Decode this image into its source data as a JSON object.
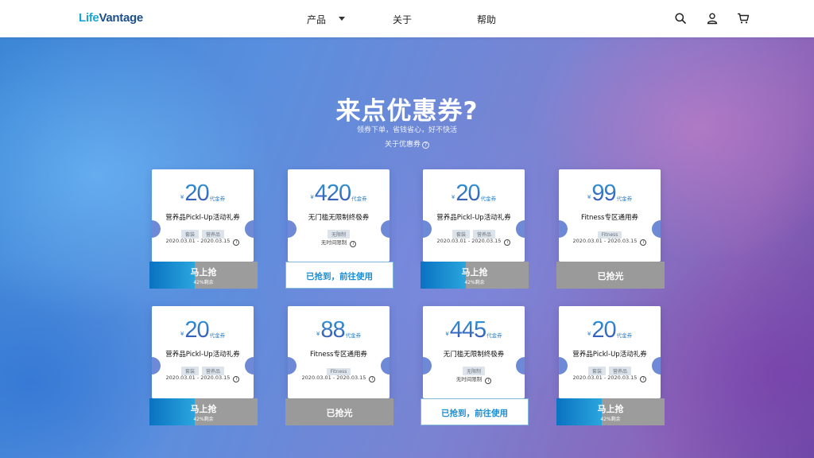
{
  "header": {
    "logo_part1": "Life",
    "logo_part2": "Vantage",
    "nav": [
      {
        "label": "产品",
        "has_dropdown": true
      },
      {
        "label": "关于"
      },
      {
        "label": "帮助"
      }
    ],
    "icons": [
      "search-icon",
      "user-icon",
      "cart-icon"
    ]
  },
  "hero": {
    "title": "来点优惠券?",
    "subtitle": "领券下单，省钱省心，好不快活",
    "link": "关于优惠券",
    "link_icon": "?"
  },
  "colors": {
    "brand_light": "#1aa5d6",
    "brand_dark": "#1d4f8a",
    "button_blue": "#1b8fd2",
    "button_gray": "#9c9c9c"
  },
  "coupons": [
    {
      "currency": "¥",
      "amount": "20",
      "unit": "代金券",
      "name": "营养品Pickl-Up活动礼券",
      "tags": [
        "套装",
        "营养品"
      ],
      "validity": "2020.03.01 - 2020.03.15",
      "state": "grab",
      "button_label": "马上抢",
      "remaining_label": "42%剩余",
      "remaining_pct": 42
    },
    {
      "currency": "¥",
      "amount": "420",
      "unit": "代金券",
      "name": "无门槛无限制终极券",
      "tags": [
        "无限制"
      ],
      "validity": "无时间限制",
      "state": "used",
      "button_label": "已抢到，前往使用"
    },
    {
      "currency": "¥",
      "amount": "20",
      "unit": "代金券",
      "name": "营养品Pickl-Up活动礼券",
      "tags": [
        "套装",
        "营养品"
      ],
      "validity": "2020.03.01 - 2020.03.15",
      "state": "grab",
      "button_label": "马上抢",
      "remaining_label": "42%剩余",
      "remaining_pct": 42
    },
    {
      "currency": "¥",
      "amount": "99",
      "unit": "代金券",
      "name": "Fitness专区通用券",
      "tags": [
        "Fitness"
      ],
      "validity": "2020.03.01 - 2020.03.15",
      "state": "sold",
      "button_label": "已抢光"
    },
    {
      "currency": "¥",
      "amount": "20",
      "unit": "代金券",
      "name": "营养品Pickl-Up活动礼券",
      "tags": [
        "套装",
        "营养品"
      ],
      "validity": "2020.03.01 - 2020.03.15",
      "state": "grab",
      "button_label": "马上抢",
      "remaining_label": "42%剩余",
      "remaining_pct": 42
    },
    {
      "currency": "¥",
      "amount": "88",
      "unit": "代金券",
      "name": "Fitness专区通用券",
      "tags": [
        "Fitness"
      ],
      "validity": "2020.03.01 - 2020.03.15",
      "state": "sold",
      "button_label": "已抢光"
    },
    {
      "currency": "¥",
      "amount": "445",
      "unit": "代金券",
      "name": "无门槛无限制终极券",
      "tags": [
        "无限制"
      ],
      "validity": "无时间限制",
      "state": "used",
      "button_label": "已抢到，前往使用"
    },
    {
      "currency": "¥",
      "amount": "20",
      "unit": "代金券",
      "name": "营养品Pickl-Up活动礼券",
      "tags": [
        "套装",
        "营养品"
      ],
      "validity": "2020.03.01 - 2020.03.15",
      "state": "grab",
      "button_label": "马上抢",
      "remaining_label": "42%剩余",
      "remaining_pct": 42
    }
  ]
}
